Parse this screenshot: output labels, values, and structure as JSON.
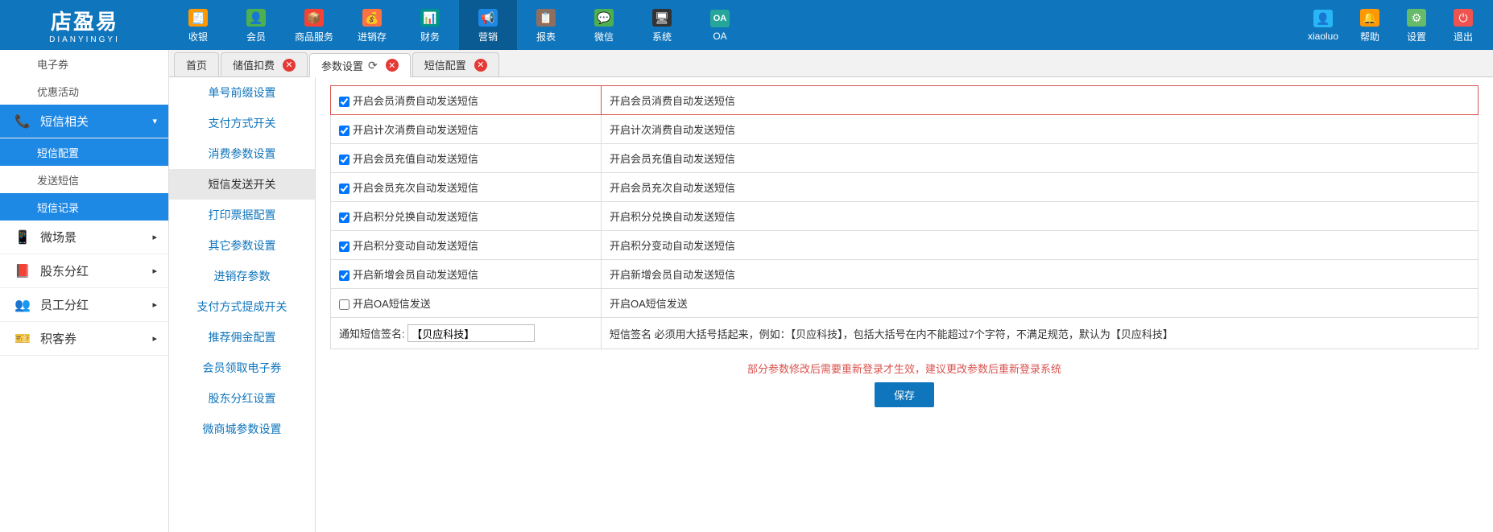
{
  "logo": {
    "main": "店盈易",
    "sub": "DIANYINGYI"
  },
  "nav": [
    {
      "label": "收银",
      "icon": "🧾"
    },
    {
      "label": "会员",
      "icon": "👤"
    },
    {
      "label": "商品服务",
      "icon": "📦"
    },
    {
      "label": "进销存",
      "icon": "💰"
    },
    {
      "label": "财务",
      "icon": "📊"
    },
    {
      "label": "营销",
      "icon": "📢",
      "active": true
    },
    {
      "label": "报表",
      "icon": "📋"
    },
    {
      "label": "微信",
      "icon": "💬"
    },
    {
      "label": "系统",
      "icon": "🖥"
    },
    {
      "label": "OA",
      "icon": "OA"
    }
  ],
  "navRight": [
    {
      "label": "xiaoluo",
      "icon": "👤"
    },
    {
      "label": "帮助",
      "icon": "🔔"
    },
    {
      "label": "设置",
      "icon": "⚙"
    },
    {
      "label": "退出",
      "icon": "⏻"
    }
  ],
  "sidebar": {
    "pre": [
      {
        "label": "电子券"
      },
      {
        "label": "优惠活动"
      }
    ],
    "activeGroup": {
      "label": "短信相关",
      "icon": "📞"
    },
    "subs": [
      {
        "label": "短信配置",
        "active": true
      },
      {
        "label": "发送短信"
      },
      {
        "label": "短信记录",
        "active": true
      }
    ],
    "post": [
      {
        "label": "微场景",
        "icon": "📱"
      },
      {
        "label": "股东分红",
        "icon": "📕"
      },
      {
        "label": "员工分红",
        "icon": "👥"
      },
      {
        "label": "积客券",
        "icon": "🎫"
      }
    ]
  },
  "tabs": [
    {
      "label": "首页",
      "closable": false
    },
    {
      "label": "储值扣费",
      "closable": true
    },
    {
      "label": "参数设置",
      "closable": true,
      "refresh": true,
      "active": true
    },
    {
      "label": "短信配置",
      "closable": true
    }
  ],
  "subSidebar": [
    {
      "label": "单号前缀设置"
    },
    {
      "label": "支付方式开关"
    },
    {
      "label": "消费参数设置"
    },
    {
      "label": "短信发送开关",
      "active": true
    },
    {
      "label": "打印票据配置"
    },
    {
      "label": "其它参数设置"
    },
    {
      "label": "进销存参数"
    },
    {
      "label": "支付方式提成开关"
    },
    {
      "label": "推荐佣金配置"
    },
    {
      "label": "会员领取电子券"
    },
    {
      "label": "股东分红设置"
    },
    {
      "label": "微商城参数设置"
    }
  ],
  "rows": [
    {
      "chk": true,
      "left": "开启会员消费自动发送短信",
      "right": "开启会员消费自动发送短信",
      "highlight": true
    },
    {
      "chk": true,
      "left": "开启计次消费自动发送短信",
      "right": "开启计次消费自动发送短信"
    },
    {
      "chk": true,
      "left": "开启会员充值自动发送短信",
      "right": "开启会员充值自动发送短信"
    },
    {
      "chk": true,
      "left": "开启会员充次自动发送短信",
      "right": "开启会员充次自动发送短信"
    },
    {
      "chk": true,
      "left": "开启积分兑换自动发送短信",
      "right": "开启积分兑换自动发送短信"
    },
    {
      "chk": true,
      "left": "开启积分变动自动发送短信",
      "right": "开启积分变动自动发送短信"
    },
    {
      "chk": true,
      "left": "开启新增会员自动发送短信",
      "right": "开启新增会员自动发送短信"
    },
    {
      "chk": false,
      "left": "开启OA短信发送",
      "right": "开启OA短信发送"
    }
  ],
  "signRow": {
    "label": "通知短信签名:",
    "value": "【贝应科技】",
    "desc": "短信签名 必须用大括号括起来，例如：【贝应科技】，包括大括号在内不能超过7个字符，不满足规范，默认为【贝应科技】"
  },
  "note": "部分参数修改后需要重新登录才生效，建议更改参数后重新登录系统",
  "saveLabel": "保存"
}
